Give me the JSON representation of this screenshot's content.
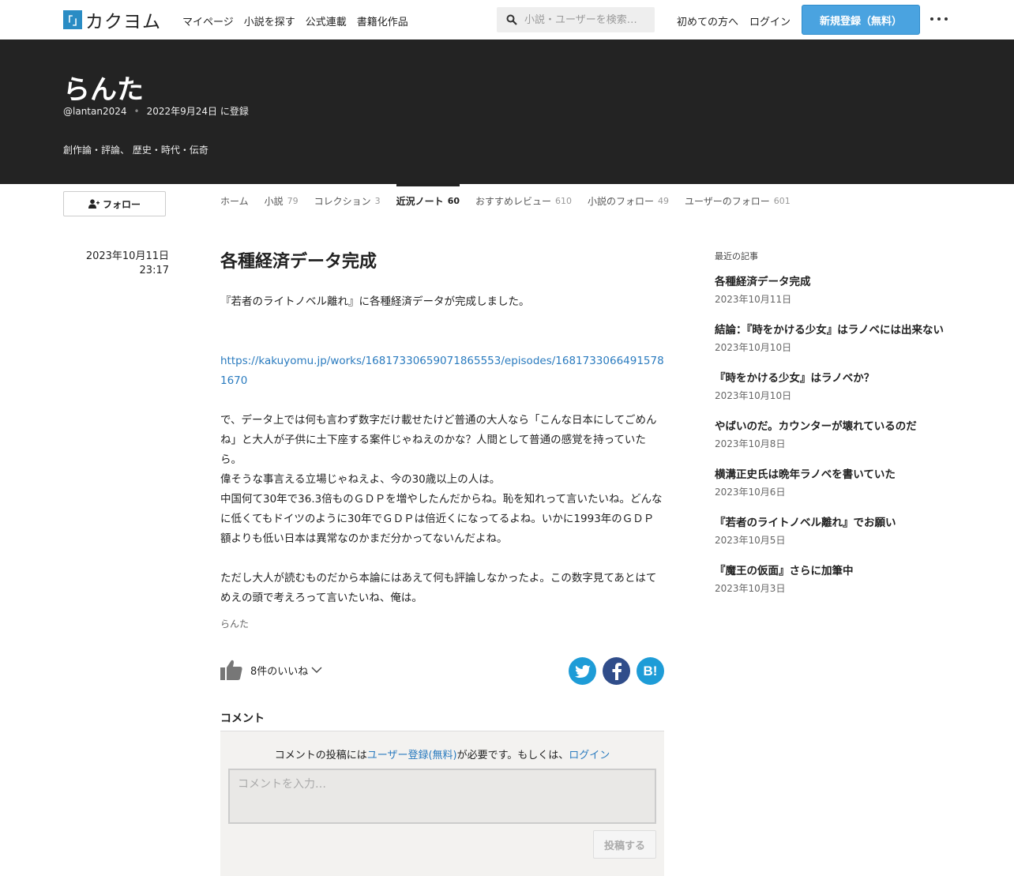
{
  "header": {
    "logo_mark": "「」",
    "logo_text": "カクヨム",
    "nav": [
      "マイページ",
      "小説を探す",
      "公式連載",
      "書籍化作品"
    ],
    "search_placeholder": "小説・ユーザーを検索…",
    "first_time": "初めての方へ",
    "login": "ログイン",
    "register": "新規登録（無料）"
  },
  "profile": {
    "name": "らんた",
    "handle": "@lantan2024",
    "joined": "2022年9月24日 に登録",
    "genres": "創作論・評論、 歴史・時代・伝奇"
  },
  "follow_label": "フォロー",
  "tabs": [
    {
      "label": "ホーム",
      "count": ""
    },
    {
      "label": "小説",
      "count": "79"
    },
    {
      "label": "コレクション",
      "count": "3"
    },
    {
      "label": "近況ノート",
      "count": "60"
    },
    {
      "label": "おすすめレビュー",
      "count": "610"
    },
    {
      "label": "小説のフォロー",
      "count": "49"
    },
    {
      "label": "ユーザーのフォロー",
      "count": "601"
    }
  ],
  "post": {
    "date": "2023年10月11日",
    "time": "23:17",
    "title": "各種経済データ完成",
    "p1": "『若者のライトノベル離れ』に各種経済データが完成しました。",
    "link": "https://kakuyomu.jp/works/16817330659071865553/episodes/16817330664915781670",
    "p2": "で、データ上では何も言わず数字だけ載せたけど普通の大人なら「こんな日本にしてごめんね」と大人が子供に土下座する案件じゃねえのかな？人間として普通の感覚を持っていたら。",
    "p3": "偉そうな事言える立場じゃねえよ、今の30歳以上の人は。",
    "p4": "中国何て30年で36.3倍ものＧＤＰを増やしたんだからね。恥を知れって言いたいね。どんなに低くてもドイツのように30年でＧＤＰは倍近くになってるよね。いかに1993年のＧＤＰ額よりも低い日本は異常なのかまだ分かってないんだよね。",
    "p5": "ただし大人が読むものだから本論にはあえて何も評論しなかったよ。この数字見てあとはてめえの頭で考えろって言いたいね、俺は。",
    "author": "らんた",
    "likes": "8件のいいね"
  },
  "comment": {
    "heading": "コメント",
    "msg_pre": "コメントの投稿には",
    "msg_link1": "ユーザー登録(無料)",
    "msg_mid": "が必要です。もしくは、",
    "msg_link2": "ログイン",
    "placeholder": "コメントを入力…",
    "submit": "投稿する"
  },
  "sidebar": {
    "heading": "最近の記事",
    "items": [
      {
        "title": "各種経済データ完成",
        "date": "2023年10月11日"
      },
      {
        "title": "結論：『時をかける少女』はラノベには出来ない",
        "date": "2023年10月10日"
      },
      {
        "title": "『時をかける少女』はラノベか？",
        "date": "2023年10月10日"
      },
      {
        "title": "やばいのだ。カウンターが壊れているのだ",
        "date": "2023年10月8日"
      },
      {
        "title": "横溝正史氏は晩年ラノベを書いていた",
        "date": "2023年10月6日"
      },
      {
        "title": "『若者のライトノベル離れ』でお願い",
        "date": "2023年10月5日"
      },
      {
        "title": "『魔王の仮面』さらに加筆中",
        "date": "2023年10月3日"
      }
    ]
  },
  "colors": {
    "accent": "#4aa3e0",
    "link": "#2a7bbf",
    "profile_bg": "#232323"
  }
}
